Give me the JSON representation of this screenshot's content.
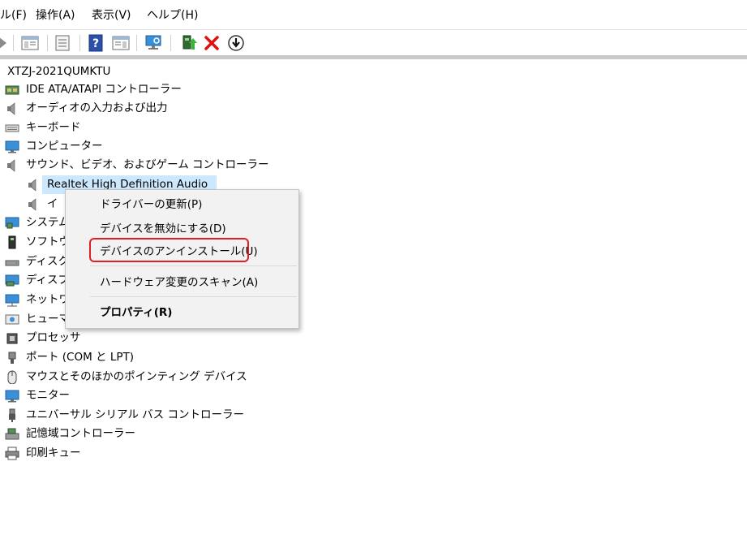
{
  "menubar": {
    "items": [
      "ル(F)",
      "操作(A)",
      "表示(V)",
      "ヘルプ(H)"
    ]
  },
  "tree": {
    "root": "XTZJ-2021QUMKTU",
    "items": [
      {
        "label": "IDE ATA/ATAPI コントローラー",
        "icon": "ide-controller-icon"
      },
      {
        "label": "オーディオの入力および出力",
        "icon": "speaker-icon"
      },
      {
        "label": "キーボード",
        "icon": "keyboard-icon"
      },
      {
        "label": "コンピューター",
        "icon": "computer-icon"
      },
      {
        "label": "サウンド、ビデオ、およびゲーム コントローラー",
        "icon": "speaker-icon"
      },
      {
        "label": "Realtek High Definition Audio",
        "icon": "speaker-icon"
      },
      {
        "label": "イ",
        "icon": "speaker-icon"
      },
      {
        "label": "システム",
        "icon": "system-icon"
      },
      {
        "label": "ソフトウ",
        "icon": "software-icon"
      },
      {
        "label": "ディスク",
        "icon": "disk-icon"
      },
      {
        "label": "ディスプ",
        "icon": "display-adapter-icon"
      },
      {
        "label": "ネットワ",
        "icon": "network-icon"
      },
      {
        "label": "ヒューマ",
        "icon": "hid-icon"
      },
      {
        "label": "プロセッサ",
        "icon": "processor-icon"
      },
      {
        "label": "ポート (COM と LPT)",
        "icon": "port-icon"
      },
      {
        "label": "マウスとそのほかのポインティング デバイス",
        "icon": "mouse-icon"
      },
      {
        "label": "モニター",
        "icon": "monitor-icon"
      },
      {
        "label": "ユニバーサル シリアル バス コントローラー",
        "icon": "usb-icon"
      },
      {
        "label": "記憶域コントローラー",
        "icon": "storage-controller-icon"
      },
      {
        "label": "印刷キュー",
        "icon": "printer-icon"
      }
    ]
  },
  "context_menu": {
    "update_driver": "ドライバーの更新(P)",
    "disable_device": "デバイスを無効にする(D)",
    "uninstall_device": "デバイスのアンインストール(U)",
    "scan_hardware": "ハードウェア変更のスキャン(A)",
    "properties": "プロパティ(R)"
  },
  "colors": {
    "selection": "#cce8ff",
    "highlight_border": "#e02020",
    "menu_bg": "#f2f2f2"
  }
}
